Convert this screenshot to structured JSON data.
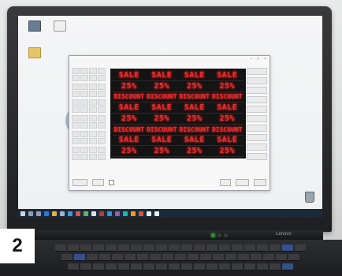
{
  "badge": "2",
  "desktop_icons": [
    "BarTender (unreadable)",
    "Notepad (unreadable)",
    "Folder"
  ],
  "recycle_bin": "Recycle Bin",
  "app": {
    "title": "",
    "led_rows": [
      {
        "style": "big",
        "items": [
          "SALE",
          "SALE",
          "SALE",
          "SALE"
        ]
      },
      {
        "style": "big",
        "items": [
          "25%",
          "25%",
          "25%",
          "25%"
        ]
      },
      {
        "style": "disc",
        "items": [
          "DISCOUNT",
          "DISCOUNT",
          "DISCOUNT",
          "DISCOUNT"
        ]
      },
      {
        "style": "big",
        "items": [
          "SALE",
          "SALE",
          "SALE",
          "SALE"
        ]
      },
      {
        "style": "big",
        "items": [
          "25%",
          "25%",
          "25%",
          "25%"
        ]
      },
      {
        "style": "disc",
        "items": [
          "DISCOUNT",
          "DISCOUNT",
          "DISCOUNT",
          "DISCOUNT"
        ]
      },
      {
        "style": "big",
        "items": [
          "SALE",
          "SALE",
          "SALE",
          "SALE"
        ]
      },
      {
        "style": "big",
        "items": [
          "25%",
          "25%",
          "25%",
          "25%"
        ]
      }
    ]
  },
  "background_brand_fragment": "ys",
  "laptop_brand": "Lenovo",
  "colors": {
    "led_red": "#e52d2d",
    "led_bg": "#141414",
    "taskbar": "#1b2a3a"
  }
}
